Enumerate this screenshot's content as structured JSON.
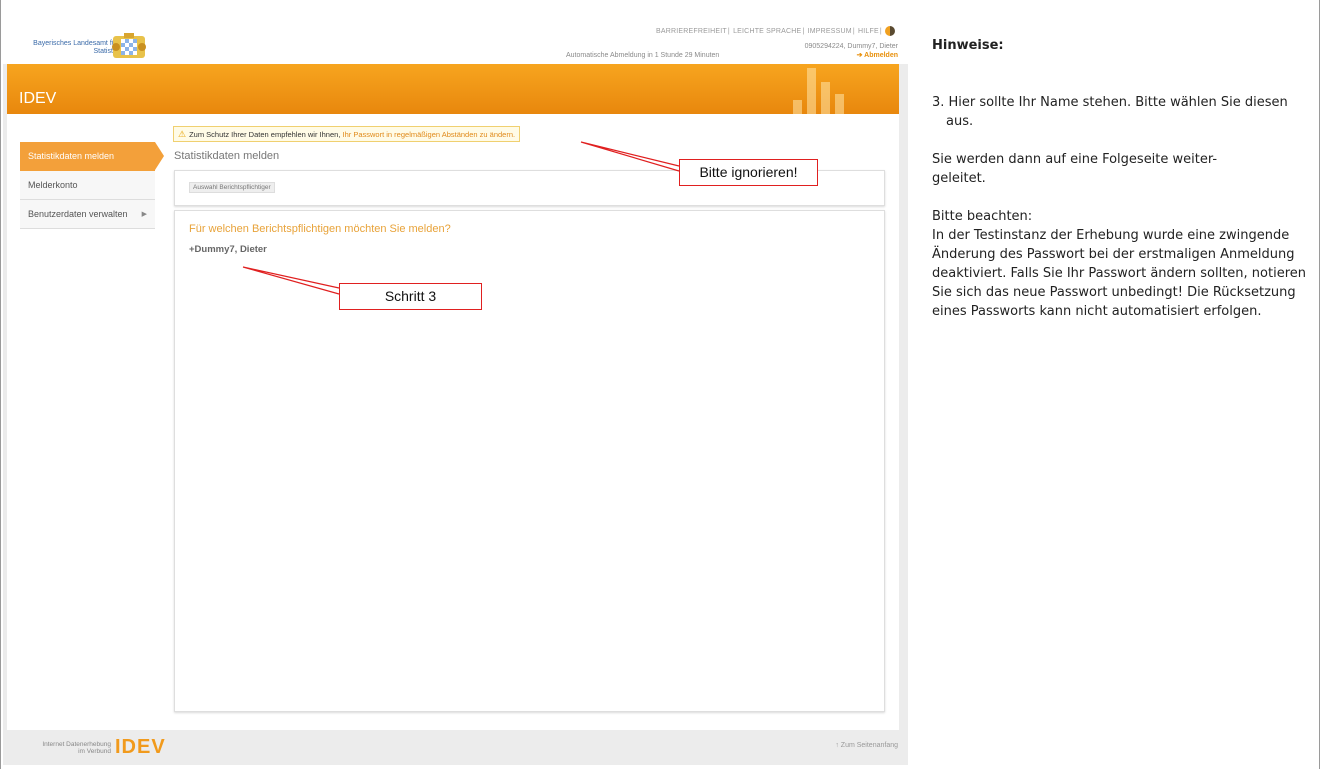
{
  "header": {
    "org_line1": "Bayerisches Landesamt für",
    "org_line2": "Statistik",
    "links": [
      "BARRIEREFREIHEIT",
      "LEICHTE SPRACHE",
      "IMPRESSUM",
      "HILFE"
    ],
    "user_line": "0905294224, Dummy7, Dieter",
    "logout_label": "➔ Abmelden",
    "auto_logout": "Automatische Abmeldung in 1 Stunde 29 Minuten"
  },
  "banner": {
    "title": "IDEV"
  },
  "sidebar": {
    "items": [
      {
        "label": "Statistikdaten melden"
      },
      {
        "label": "Melderkonto"
      },
      {
        "label": "Benutzerdaten verwalten"
      }
    ]
  },
  "warning": {
    "text": "Zum Schutz Ihrer Daten empfehlen wir Ihnen,",
    "link": "Ihr Passwort in regelmäßigen Abständen zu ändern."
  },
  "main": {
    "heading": "Statistikdaten melden",
    "breadcrumb_chip": "Auswahl Berichtspflichtiger",
    "question": "Für welchen Berichtspflichtigen möchten Sie melden?",
    "reporter": "+Dummy7, Dieter"
  },
  "footer": {
    "line1": "Internet Datenerhebung",
    "line2": "im Verbund",
    "logo": "IDEV",
    "to_top": "↑ Zum Seitenanfang"
  },
  "annotations": {
    "ignore": "Bitte ignorieren!",
    "step": "Schritt 3",
    "color": "#e02020"
  },
  "notes": {
    "title": "Hinweise:",
    "step3_line1": "3. Hier sollte Ihr Name stehen. Bitte wählen Sie diesen",
    "step3_line2": "aus.",
    "redirect_line1": "Sie werden dann auf eine Folgeseite weiter-",
    "redirect_line2": "geleitet.",
    "attention_title": "Bitte beachten:",
    "attention_lines": [
      "In der Testinstanz der Erhebung wurde eine zwingende",
      "Änderung des Passwort bei der erstmaligen Anmeldung",
      "deaktiviert. Falls Sie Ihr Passwort ändern sollten, notieren",
      "Sie sich das neue Passwort unbedingt! Die Rücksetzung",
      "eines Passworts kann nicht automatisiert erfolgen."
    ]
  },
  "colors": {
    "accent": "#f19a1c",
    "link": "#3a6aa8"
  }
}
